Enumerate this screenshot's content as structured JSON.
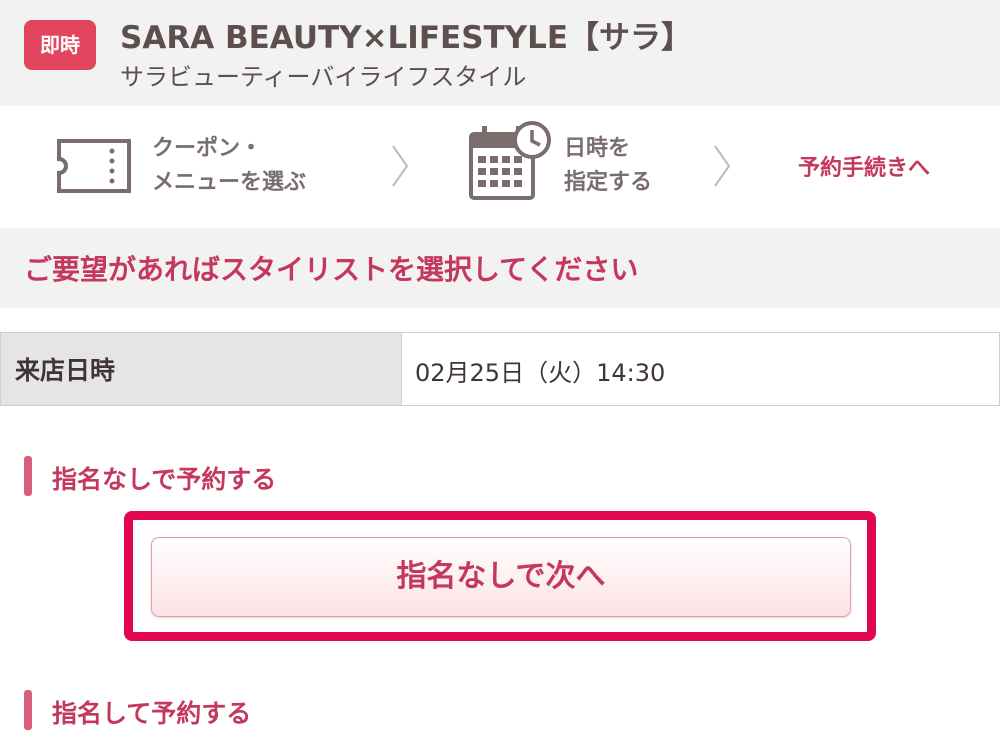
{
  "header": {
    "badge": "即時",
    "shop_name": "SARA BEAUTY×LIFESTYLE【サラ】",
    "shop_kana": "サラビューティーバイライフスタイル"
  },
  "steps": {
    "items": [
      {
        "line1": "クーポン・",
        "line2": "メニューを選ぶ",
        "icon": "coupon-ticket-icon"
      },
      {
        "line1": "日時を",
        "line2": "指定する",
        "icon": "calendar-clock-icon"
      }
    ],
    "final": "予約手続きへ",
    "accent": "#c5385d"
  },
  "notice": "ご要望があればスタイリストを選択してください",
  "visit": {
    "label": "来店日時",
    "value": "02月25日（火）14:30"
  },
  "no_designation": {
    "heading": "指名なしで予約する",
    "button": "指名なしで次へ"
  },
  "designation": {
    "heading": "指名して予約する"
  },
  "colors": {
    "brand": "#e2465e",
    "highlight": "#e0064f",
    "background": "#f3f2f2"
  }
}
